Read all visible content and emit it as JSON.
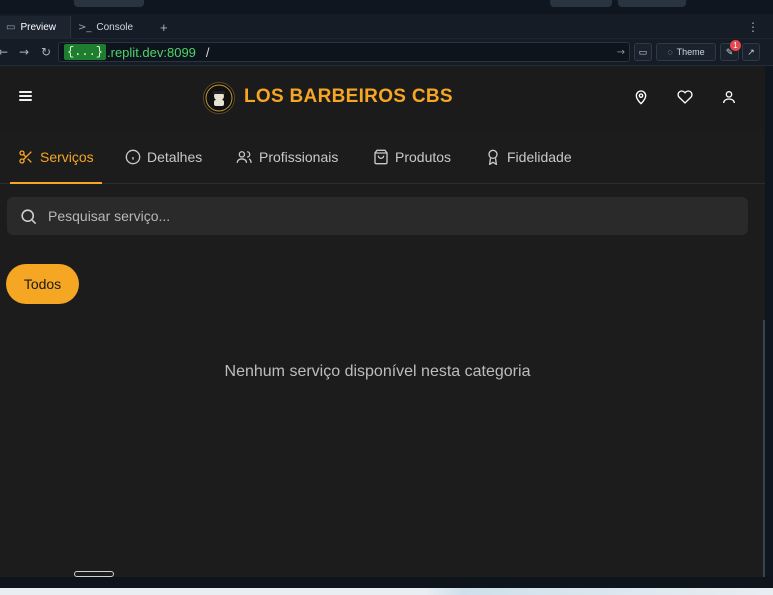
{
  "browser": {
    "tabs": [
      {
        "label": "Preview",
        "icon": "monitor-icon",
        "active": true
      },
      {
        "label": "Console",
        "icon": "terminal-icon",
        "active": false
      }
    ],
    "new_tab": "+",
    "url": {
      "badge": "{...}",
      "host": ".replit.dev:8099",
      "path": "/"
    },
    "theme_label": "Theme",
    "devtools_badge": "1"
  },
  "app": {
    "brand": "LOS BARBEIROS CBS",
    "accent": "#f5a623",
    "nav_tabs": [
      {
        "label": "Serviços",
        "icon": "scissors-icon",
        "active": true
      },
      {
        "label": "Detalhes",
        "icon": "info-icon",
        "active": false
      },
      {
        "label": "Profissionais",
        "icon": "users-icon",
        "active": false
      },
      {
        "label": "Produtos",
        "icon": "shopping-bag-icon",
        "active": false
      },
      {
        "label": "Fidelidade",
        "icon": "award-icon",
        "active": false
      }
    ],
    "search": {
      "placeholder": "Pesquisar serviço..."
    },
    "categories": [
      "Todos"
    ],
    "empty_message": "Nenhum serviço disponível nesta categoria"
  }
}
